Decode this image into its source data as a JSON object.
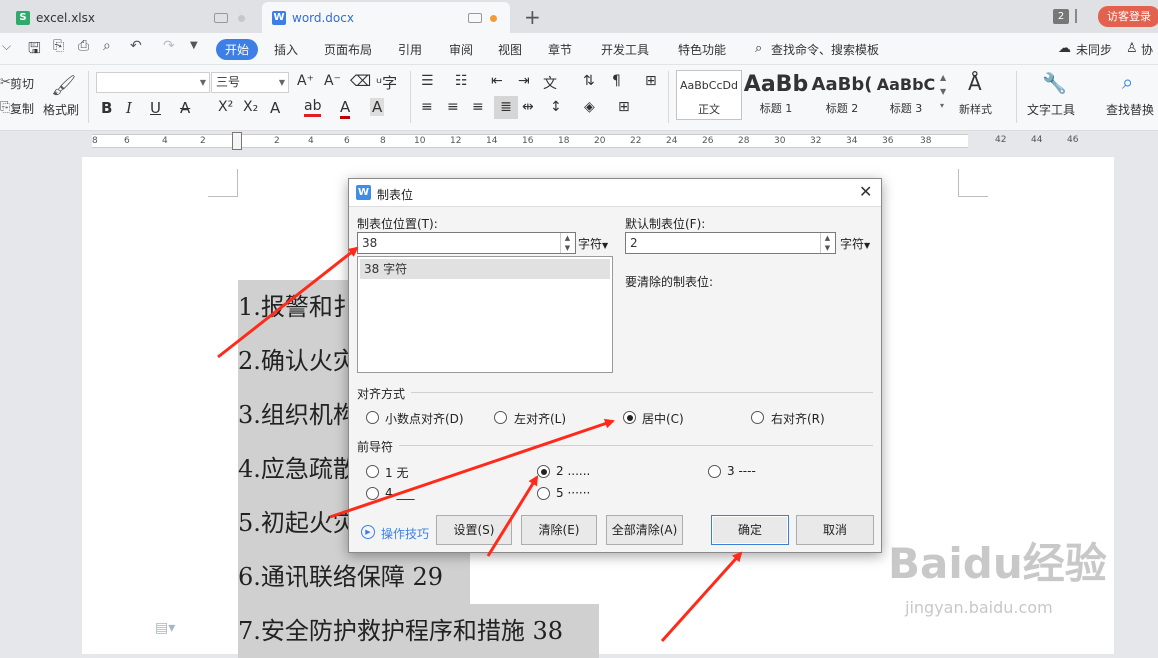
{
  "tabs": [
    {
      "label": "excel.xlsx",
      "icon": "S"
    },
    {
      "label": "word.docx",
      "icon": "W"
    }
  ],
  "tab_count": "2",
  "login_button": "访客登录",
  "menu": {
    "items": [
      "开始",
      "插入",
      "页面布局",
      "引用",
      "审阅",
      "视图",
      "章节",
      "开发工具",
      "特色功能"
    ],
    "search": "查找命令、搜索模板",
    "sync": "未同步",
    "collab": "协"
  },
  "ribbon": {
    "cut": "剪切",
    "copy": "复制",
    "format_painter": "格式刷",
    "font_size": "三号",
    "styles": [
      {
        "preview": "AaBbCcDd",
        "name": "正文"
      },
      {
        "preview": "AaBb",
        "name": "标题 1"
      },
      {
        "preview": "AaBb(",
        "name": "标题 2"
      },
      {
        "preview": "AaBbC",
        "name": "标题 3"
      }
    ],
    "new_style": "新样式",
    "text_tools": "文字工具",
    "find_replace": "查找替换"
  },
  "ruler_numbers": [
    "8",
    "6",
    "4",
    "2",
    "2",
    "4",
    "6",
    "8",
    "10",
    "12",
    "14",
    "16",
    "18",
    "20",
    "22",
    "24",
    "26",
    "28",
    "30",
    "32",
    "34",
    "36",
    "38",
    "42",
    "44",
    "46"
  ],
  "document": {
    "lines": [
      "1.报警和扌",
      "2.确认火灾",
      "3.组织机构",
      "4.应急疏散",
      "5.初起火灾",
      "6.通讯联络保障 29",
      "7.安全防护救护程序和措施 38"
    ]
  },
  "watermark": {
    "brand": "Baidu经验",
    "url": "jingyan.baidu.com"
  },
  "dialog": {
    "title": "制表位",
    "tab_position_label": "制表位位置(T):",
    "tab_position_value": "38",
    "unit": "字符",
    "default_tab_label": "默认制表位(F):",
    "default_tab_value": "2",
    "default_unit": "字符",
    "tab_list": [
      "38 字符"
    ],
    "clear_label": "要清除的制表位:",
    "alignment_label": "对齐方式",
    "alignment_options": [
      "小数点对齐(D)",
      "左对齐(L)",
      "居中(C)",
      "右对齐(R)"
    ],
    "alignment_selected": "居中(C)",
    "leader_label": "前导符",
    "leader_options": [
      "1 无",
      "2 ......",
      "3 ----",
      "4 ___",
      "5 ······"
    ],
    "leader_selected": "2 ......",
    "tips": "操作技巧",
    "buttons": {
      "set": "设置(S)",
      "clear": "清除(E)",
      "clear_all": "全部清除(A)",
      "ok": "确定",
      "cancel": "取消"
    }
  },
  "colors": {
    "accent": "#3d7fe6",
    "arrow": "#ff2a1a",
    "login": "#e3614f"
  }
}
